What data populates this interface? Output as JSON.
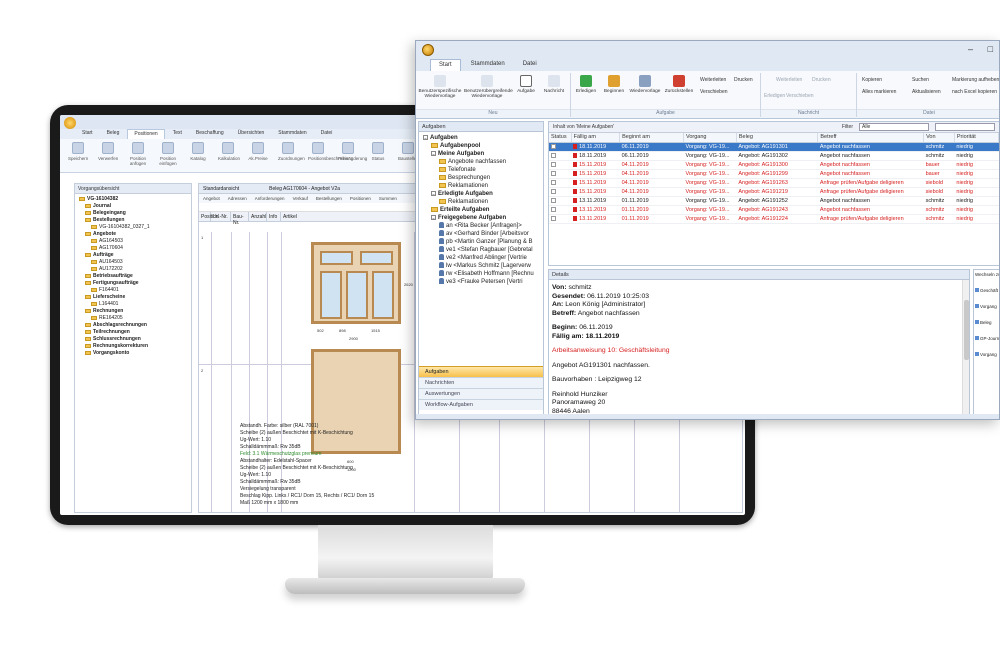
{
  "back_app": {
    "title": "",
    "tabs": [
      "Start",
      "Beleg",
      "Positionen",
      "Text",
      "Beschaffung",
      "Übersichten",
      "Stammdaten",
      "Datei"
    ],
    "active_tab": "Positionen",
    "ribbon": [
      "Speichern",
      "Verwerfen",
      "Position anfügen",
      "Position einfügen",
      "Katalog",
      "Kalkulation",
      "Ak.Preise",
      "Zuordnungen",
      "Positionsbeschreibung",
      "Preisänderung",
      "Status",
      "Baustellen",
      "Kopieren",
      "Einfügen"
    ],
    "ribbon_groups": [
      "Speichern",
      "Neu",
      "Positionen",
      "Position"
    ],
    "tree_header": "Vorgangsübersicht",
    "tree": [
      {
        "label": "VG-16104382",
        "level": 0,
        "bold": true
      },
      {
        "label": "Journal",
        "level": 1,
        "bold": true
      },
      {
        "label": "Belegeingang",
        "level": 1,
        "bold": true
      },
      {
        "label": "Bestellungen",
        "level": 1,
        "bold": true
      },
      {
        "label": "VG-16104382_0327_1",
        "level": 2,
        "bold": false
      },
      {
        "label": "Angebote",
        "level": 1,
        "bold": true
      },
      {
        "label": "AG164503",
        "level": 2,
        "bold": false
      },
      {
        "label": "AG170604",
        "level": 2,
        "bold": false
      },
      {
        "label": "Aufträge",
        "level": 1,
        "bold": true
      },
      {
        "label": "AU164503",
        "level": 2,
        "bold": false
      },
      {
        "label": "AU172202",
        "level": 2,
        "bold": false
      },
      {
        "label": "Betriebsaufträge",
        "level": 1,
        "bold": true
      },
      {
        "label": "Fertigungsaufträge",
        "level": 1,
        "bold": true
      },
      {
        "label": "F164401",
        "level": 2,
        "bold": false
      },
      {
        "label": "Lieferscheine",
        "level": 1,
        "bold": true
      },
      {
        "label": "L164401",
        "level": 2,
        "bold": false
      },
      {
        "label": "Rechnungen",
        "level": 1,
        "bold": true
      },
      {
        "label": "RE164205",
        "level": 2,
        "bold": false
      },
      {
        "label": "Abschlagsrechnungen",
        "level": 1,
        "bold": true
      },
      {
        "label": "Teilrechnungen",
        "level": 1,
        "bold": true
      },
      {
        "label": "Schlussrechnungen",
        "level": 1,
        "bold": true
      },
      {
        "label": "Rechnungskorrekturen",
        "level": 1,
        "bold": true
      },
      {
        "label": "Vorgangskonto",
        "level": 1,
        "bold": true
      }
    ],
    "main_header": [
      "Standardansicht",
      "Beleg AG170604 - Angebot V2a"
    ],
    "subtabs": [
      "Angebot",
      "Adressen",
      "Anforderungen",
      "Verkauf",
      "Bestellungen",
      "Positionen",
      "Summen"
    ],
    "grid_headers": [
      "Position",
      "LV.-Nr.",
      "Bau-Nr.",
      "Anzahl",
      "Info",
      "Artikel"
    ],
    "positions": [
      "1",
      "2"
    ],
    "dims1": [
      "502",
      "898",
      "1515",
      "2900",
      "2620"
    ],
    "dims2": [
      "600",
      "1200"
    ],
    "specs": [
      {
        "text": "Abstandh. Farbe: silber (RAL 7001)",
        "green": false
      },
      {
        "text": "Scheibe (2) außen Beschichtet mit K-Beschichtung",
        "green": false
      },
      {
        "text": "Ug-Wert: 1.10",
        "green": false
      },
      {
        "text": "Schalldämmmaß: Rw 35dB",
        "green": false
      },
      {
        "text": "Feld: 3.1 Wärmeschutzglas premium",
        "green": true
      },
      {
        "text": "Abstandhalter: Edelstahl-Spacer",
        "green": false
      },
      {
        "text": "Scheibe (2) außen Beschichtet mit K-Beschichtung",
        "green": false
      },
      {
        "text": "Ug-Wert: 1.10",
        "green": false
      },
      {
        "text": "Schalldämmmaß: Rw 35dB",
        "green": false
      },
      {
        "text": "Versiegelung    transparent",
        "green": false
      },
      {
        "text": "Beschlag    Kipp. Links / RC1/ Dorn 15, Rechts / RC1/ Dorn 15",
        "green": false
      },
      {
        "text": "Maß    1200 mm x 1800 mm",
        "green": false
      }
    ]
  },
  "front_app": {
    "tabs": [
      "Start",
      "Stammdaten",
      "Datei"
    ],
    "active_tab": "Start",
    "window_buttons": [
      "–",
      "□"
    ],
    "ribbon": {
      "neu": [
        "Benutzerspezifische Wiedervorlage",
        "Benutzerübergreifende Wiedervorlage"
      ],
      "aufgabe_big": [
        "Aufgabe",
        "Nachricht",
        "Erledigen",
        "Beginnen",
        "Wiedervorlage",
        "Zurückstellen"
      ],
      "aufgabe_small": [
        "Weiterleiten",
        "Drucken",
        "Verschieben"
      ],
      "nachricht": [
        "Erledigen",
        "Weiterleiten",
        "Drucken",
        "Verschieben"
      ],
      "datei": [
        "Kopieren",
        "Suchen",
        "Markierung aufheben",
        "Alles markieren",
        "Aktualisieren",
        "nach Excel kopieren"
      ]
    },
    "ribbon_groups": [
      "Neu",
      "Aufgabe",
      "Nachricht",
      "Datei"
    ],
    "left_header": "Aufgaben",
    "tree": [
      {
        "label": "Aufgaben",
        "indent": 0,
        "bold": true,
        "kind": "ex"
      },
      {
        "label": "Aufgabenpool",
        "indent": 1,
        "bold": true,
        "kind": "fold"
      },
      {
        "label": "Meine Aufgaben",
        "indent": 1,
        "bold": true,
        "kind": "ex"
      },
      {
        "label": "Angebote nachfassen",
        "indent": 2,
        "bold": false,
        "kind": "fold"
      },
      {
        "label": "Telefonate",
        "indent": 2,
        "bold": false,
        "kind": "fold"
      },
      {
        "label": "Besprechungen",
        "indent": 2,
        "bold": false,
        "kind": "fold"
      },
      {
        "label": "Reklamationen",
        "indent": 2,
        "bold": false,
        "kind": "fold"
      },
      {
        "label": "Erledigte Aufgaben",
        "indent": 1,
        "bold": true,
        "kind": "ex"
      },
      {
        "label": "Reklamationen",
        "indent": 2,
        "bold": false,
        "kind": "fold"
      },
      {
        "label": "Erteilte Aufgaben",
        "indent": 1,
        "bold": true,
        "kind": "fold"
      },
      {
        "label": "Freigegebene Aufgaben",
        "indent": 1,
        "bold": true,
        "kind": "ex"
      },
      {
        "label": "an <Rita Becker [Anfragen]>",
        "indent": 2,
        "bold": false,
        "kind": "pers"
      },
      {
        "label": "av <Gerhard Binder [Arbeitsvor",
        "indent": 2,
        "bold": false,
        "kind": "pers"
      },
      {
        "label": "pb <Martin Ganzer [Planung & B",
        "indent": 2,
        "bold": false,
        "kind": "pers"
      },
      {
        "label": "ve1 <Stefan Ragbauer [Gebretal",
        "indent": 2,
        "bold": false,
        "kind": "pers"
      },
      {
        "label": "ve2 <Manfred Ablinger [Vertrie",
        "indent": 2,
        "bold": false,
        "kind": "pers"
      },
      {
        "label": "lw <Markus Schmitz [Lagerverw",
        "indent": 2,
        "bold": false,
        "kind": "pers"
      },
      {
        "label": "rw <Elisabeth Hoffmann [Rechnu",
        "indent": 2,
        "bold": false,
        "kind": "pers"
      },
      {
        "label": "ve3 <Frauke Petersen  [Vertri",
        "indent": 2,
        "bold": false,
        "kind": "pers"
      }
    ],
    "nav": [
      "Aufgaben",
      "Nachrichten",
      "Auswertungen",
      "Workflow-Aufgaben"
    ],
    "list_bar_label": "Inhalt von 'Meine Aufgaben'",
    "filter_label": "Filter",
    "filter_value": "Alle",
    "columns": [
      "Status",
      "Fällig am",
      "Beginnt am",
      "Vorgang",
      "Beleg",
      "Betreff",
      "Von",
      "Priorität"
    ],
    "rows": [
      {
        "status": "",
        "due": "18.11.2019",
        "start": "06.11.2019",
        "vorgang": "Vorgang: VG-19...",
        "beleg": "Angebot: AG191301",
        "betreff": "Angebot nachfassen",
        "von": "schmitz",
        "prio": "niedrig",
        "style": "sel"
      },
      {
        "status": "",
        "due": "18.11.2019",
        "start": "06.11.2019",
        "vorgang": "Vorgang: VG-19...",
        "beleg": "Angebot: AG191302",
        "betreff": "Angebot nachfassen",
        "von": "schmitz",
        "prio": "niedrig",
        "style": ""
      },
      {
        "status": "",
        "due": "15.11.2019",
        "start": "04.11.2019",
        "vorgang": "Vorgang: VG-19...",
        "beleg": "Angebot: AG191300",
        "betreff": "Angebot nachfassen",
        "von": "bauer",
        "prio": "niedrig",
        "style": "red"
      },
      {
        "status": "",
        "due": "15.11.2019",
        "start": "04.11.2019",
        "vorgang": "Vorgang: VG-19...",
        "beleg": "Angebot: AG191299",
        "betreff": "Angebot nachfassen",
        "von": "bauer",
        "prio": "niedrig",
        "style": "red"
      },
      {
        "status": "",
        "due": "15.11.2019",
        "start": "04.11.2019",
        "vorgang": "Vorgang: VG-19...",
        "beleg": "Angebot: AG191263",
        "betreff": "Anfrage prüfen/Aufgabe deligieren",
        "von": "siebold",
        "prio": "niedrig",
        "style": "red"
      },
      {
        "status": "",
        "due": "15.11.2019",
        "start": "04.11.2019",
        "vorgang": "Vorgang: VG-19...",
        "beleg": "Angebot: AG191219",
        "betreff": "Anfrage prüfen/Aufgabe deligieren",
        "von": "siebold",
        "prio": "niedrig",
        "style": "red"
      },
      {
        "status": "",
        "due": "13.11.2019",
        "start": "01.11.2019",
        "vorgang": "Vorgang: VG-19...",
        "beleg": "Angebot: AG191252",
        "betreff": "Angebot nachfassen",
        "von": "schmitz",
        "prio": "niedrig",
        "style": ""
      },
      {
        "status": "",
        "due": "13.11.2019",
        "start": "01.11.2019",
        "vorgang": "Vorgang: VG-19...",
        "beleg": "Angebot: AG191243",
        "betreff": "Angebot nachfassen",
        "von": "schmitz",
        "prio": "niedrig",
        "style": "red"
      },
      {
        "status": "",
        "due": "13.11.2019",
        "start": "01.11.2019",
        "vorgang": "Vorgang: VG-19...",
        "beleg": "Angebot: AG191224",
        "betreff": "Anfrage prüfen/Aufgabe deligieren",
        "von": "schmitz",
        "prio": "niedrig",
        "style": "red"
      }
    ],
    "detail_header": "Details",
    "detail": {
      "von_label": "Von:",
      "von": "schmitz",
      "gesendet_label": "Gesendet:",
      "gesendet": "06.11.2019 10:25:03",
      "an_label": "An:",
      "an": "Leon König [Administrator]",
      "betreff_label": "Betreff:",
      "betreff": "Angebot nachfassen",
      "beginn_label": "Beginn:",
      "beginn": "06.11.2019",
      "faellig_label": "Fällig am:",
      "faellig": "18.11.2019",
      "red_line": "Arbeitsanweisung 10: Geschäftsleitung",
      "line1": "Angebot AG191301 nachfassen.",
      "line2": "Bauvorhaben : Leipzigweg 12",
      "addr1": "Reinhold Hunziker",
      "addr2": "Panoramaweg 20",
      "addr3": "88446 Aalen"
    },
    "side": [
      "Wechseln zu",
      "Geschäft",
      "Vorgang",
      "Beleg",
      "GP-Journ",
      "Vorgang"
    ],
    "colors": {
      "accent": "#3a78c8",
      "overdue": "#d62020",
      "nav_active": "#f7c04a"
    }
  }
}
